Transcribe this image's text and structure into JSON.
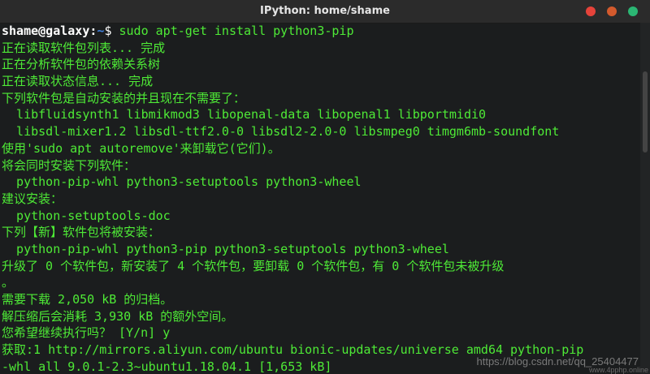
{
  "window": {
    "title": "IPython: home/shame",
    "buttons": {
      "minimize_color": "#e5433a",
      "maximize_color": "#d35a2d",
      "close_color": "#2bb673"
    }
  },
  "terminal": {
    "prompt": {
      "user_host": "shame@galaxy",
      "sep": ":",
      "path": "~",
      "dollar": "$ ",
      "command": "sudo apt-get install python3-pip"
    },
    "lines": [
      "正在读取软件包列表... 完成",
      "正在分析软件包的依赖关系树",
      "正在读取状态信息... 完成",
      "下列软件包是自动安装的并且现在不需要了：",
      "  libfluidsynth1 libmikmod3 libopenal-data libopenal1 libportmidi0",
      "  libsdl-mixer1.2 libsdl-ttf2.0-0 libsdl2-2.0-0 libsmpeg0 timgm6mb-soundfont",
      "使用'sudo apt autoremove'来卸载它(它们)。",
      "将会同时安装下列软件：",
      "  python-pip-whl python3-setuptools python3-wheel",
      "建议安装：",
      "  python-setuptools-doc",
      "下列【新】软件包将被安装：",
      "  python-pip-whl python3-pip python3-setuptools python3-wheel",
      "升级了 0 个软件包，新安装了 4 个软件包，要卸载 0 个软件包，有 0 个软件包未被升级",
      "。",
      "需要下载 2,050 kB 的归档。",
      "解压缩后会消耗 3,930 kB 的额外空间。",
      "您希望继续执行吗？ [Y/n] y",
      "获取:1 http://mirrors.aliyun.com/ubuntu bionic-updates/universe amd64 python-pip",
      "-whl all 9.0.1-2.3~ubuntu1.18.04.1 [1,653 kB]"
    ]
  },
  "watermark": {
    "text": "https://blog.csdn.net/qq_25404477",
    "sub": "www.4pphp.online"
  }
}
